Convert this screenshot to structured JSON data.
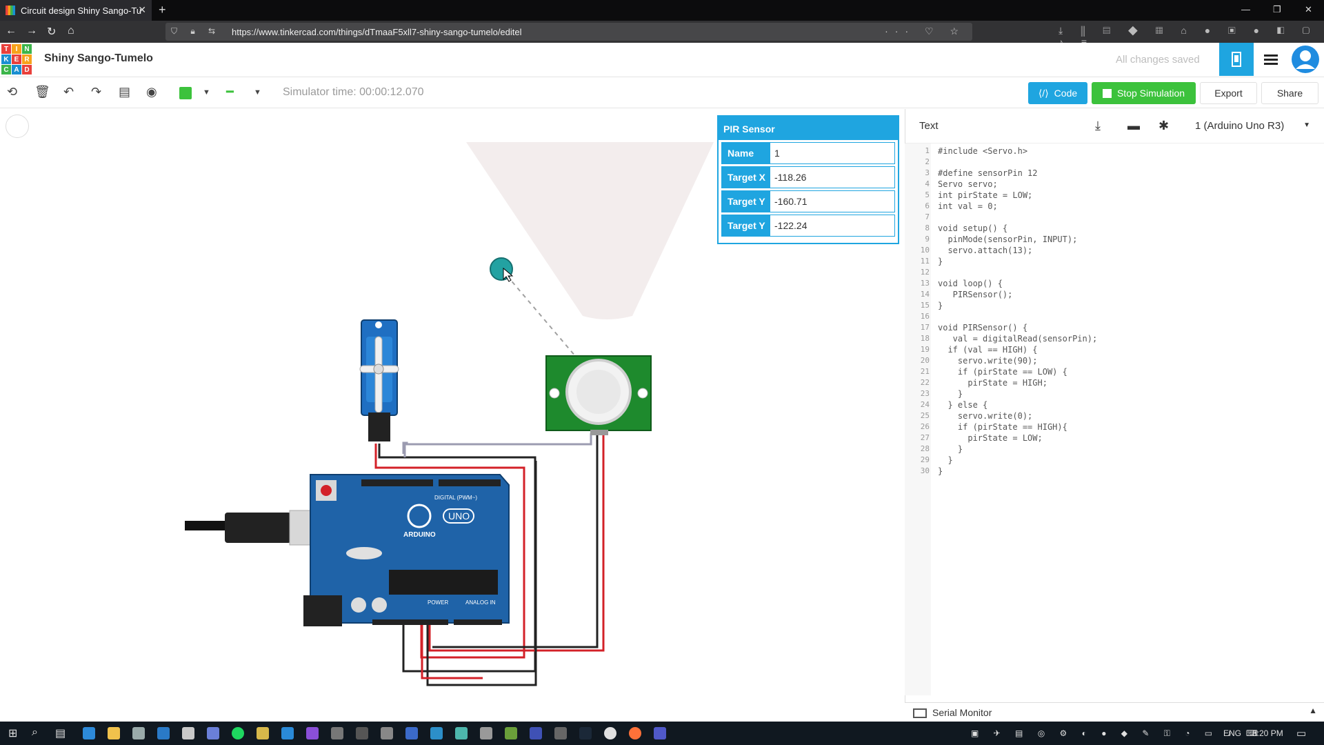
{
  "browser": {
    "tab_title": "Circuit design Shiny Sango-Tu",
    "url": "https://www.tinkercad.com/things/dTmaaF5xll7-shiny-sango-tumelo/editel"
  },
  "logo_letters": [
    "T",
    "I",
    "N",
    "K",
    "E",
    "R",
    "C",
    "A",
    "D"
  ],
  "app": {
    "project_title": "Shiny Sango-Tumelo",
    "save_status": "All changes saved"
  },
  "toolbar": {
    "simulator_time": "Simulator time: 00:00:12.070",
    "code_label": "Code",
    "stop_label": "Stop Simulation",
    "export_label": "Export",
    "share_label": "Share"
  },
  "inspector": {
    "title": "PIR Sensor",
    "rows": [
      {
        "label": "Name",
        "value": "1"
      },
      {
        "label": "Target X",
        "value": "-118.26"
      },
      {
        "label": "Target Y",
        "value": "-160.71"
      },
      {
        "label": "Target Y",
        "value": "-122.24"
      }
    ]
  },
  "code_panel": {
    "mode": "Text",
    "device": "1 (Arduino Uno R3)",
    "code": "#include <Servo.h>\n\n#define sensorPin 12\nServo servo;\nint pirState = LOW;\nint val = 0;\n\nvoid setup() {\n  pinMode(sensorPin, INPUT);\n  servo.attach(13);\n}\n\nvoid loop() {\n   PIRSensor();\n}\n\nvoid PIRSensor() {\n   val = digitalRead(sensorPin);\n  if (val == HIGH) {\n    servo.write(90);\n    if (pirState == LOW) {\n      pirState = HIGH;\n    }\n  } else {\n    servo.write(0);\n    if (pirState == HIGH){\n      pirState = LOW;\n    }\n  }\n}",
    "line_numbers": "1\n2\n3\n4\n5\n6\n7\n8\n9\n10\n11\n12\n13\n14\n15\n16\n17\n18\n19\n20\n21\n22\n23\n24\n25\n26\n27\n28\n29\n30",
    "serial_monitor": "Serial Monitor"
  },
  "board": {
    "brand": "ARDUINO",
    "model": "UNO",
    "digital_label": "DIGITAL (PWM~)",
    "power_label": "POWER",
    "analog_label": "ANALOG IN"
  },
  "taskbar": {
    "lang": "ENG",
    "time": "8:20 PM"
  },
  "colors": {
    "accent": "#1fa5e0",
    "run_green": "#3cc23c",
    "board_blue": "#1f63a8",
    "pcb_green": "#1e8a2d"
  }
}
